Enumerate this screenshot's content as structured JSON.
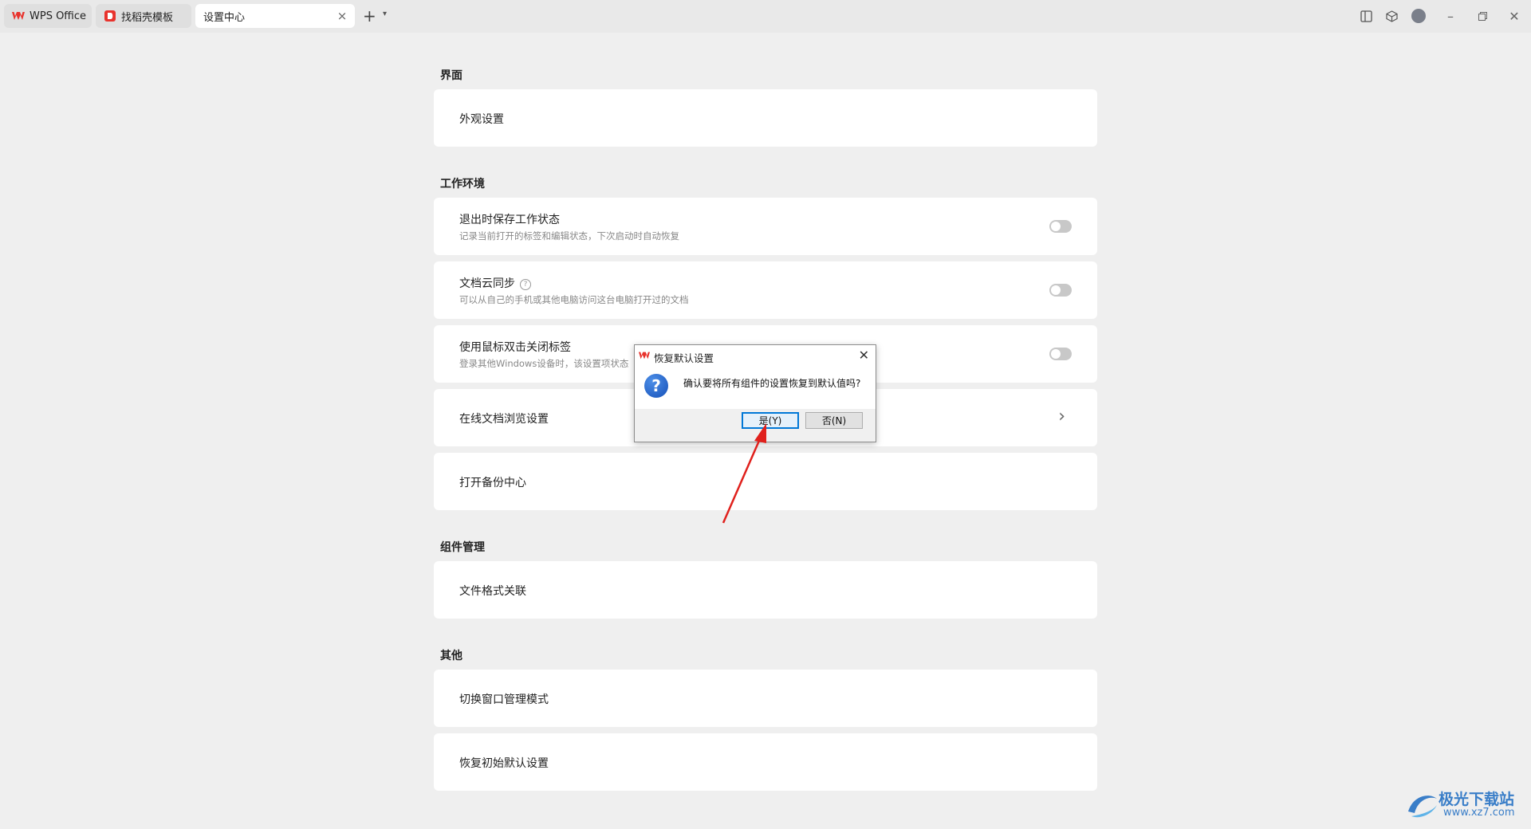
{
  "tabs": [
    {
      "label": "WPS Office"
    },
    {
      "label": "找稻壳模板"
    },
    {
      "label": "设置中心"
    }
  ],
  "icons": {
    "new_tab": "plus-icon",
    "new_tab_menu": "chevron-down-icon",
    "layout": "layout-icon",
    "package": "box-icon",
    "avatar": "avatar",
    "minimize": "minimize-icon",
    "restore": "restore-icon",
    "close": "close-icon"
  },
  "sections": {
    "interface": {
      "title": "界面",
      "appearance": "外观设置"
    },
    "work_env": {
      "title": "工作环境",
      "save_state": {
        "title": "退出时保存工作状态",
        "desc": "记录当前打开的标签和编辑状态，下次启动时自动恢复",
        "enabled": false
      },
      "cloud_sync": {
        "title": "文档云同步",
        "desc": "可以从自己的手机或其他电脑访问这台电脑打开过的文档",
        "enabled": false
      },
      "dblclick_close": {
        "title": "使用鼠标双击关闭标签",
        "desc": "登录其他Windows设备时，该设置项状态",
        "enabled": false
      },
      "online_browse": "在线文档浏览设置",
      "backup_center": "打开备份中心"
    },
    "components": {
      "title": "组件管理",
      "file_assoc": "文件格式关联"
    },
    "other": {
      "title": "其他",
      "window_mode": "切换窗口管理模式",
      "restore_defaults": "恢复初始默认设置"
    }
  },
  "dialog": {
    "title": "恢复默认设置",
    "message": "确认要将所有组件的设置恢复到默认值吗?",
    "yes": "是(Y)",
    "no": "否(N)"
  },
  "watermark": {
    "name": "极光下载站",
    "url": "www.xz7.com"
  },
  "colors": {
    "wps_red": "#e8332d",
    "annotation_arrow": "#e0201c",
    "dialog_accent": "#0078d7"
  }
}
